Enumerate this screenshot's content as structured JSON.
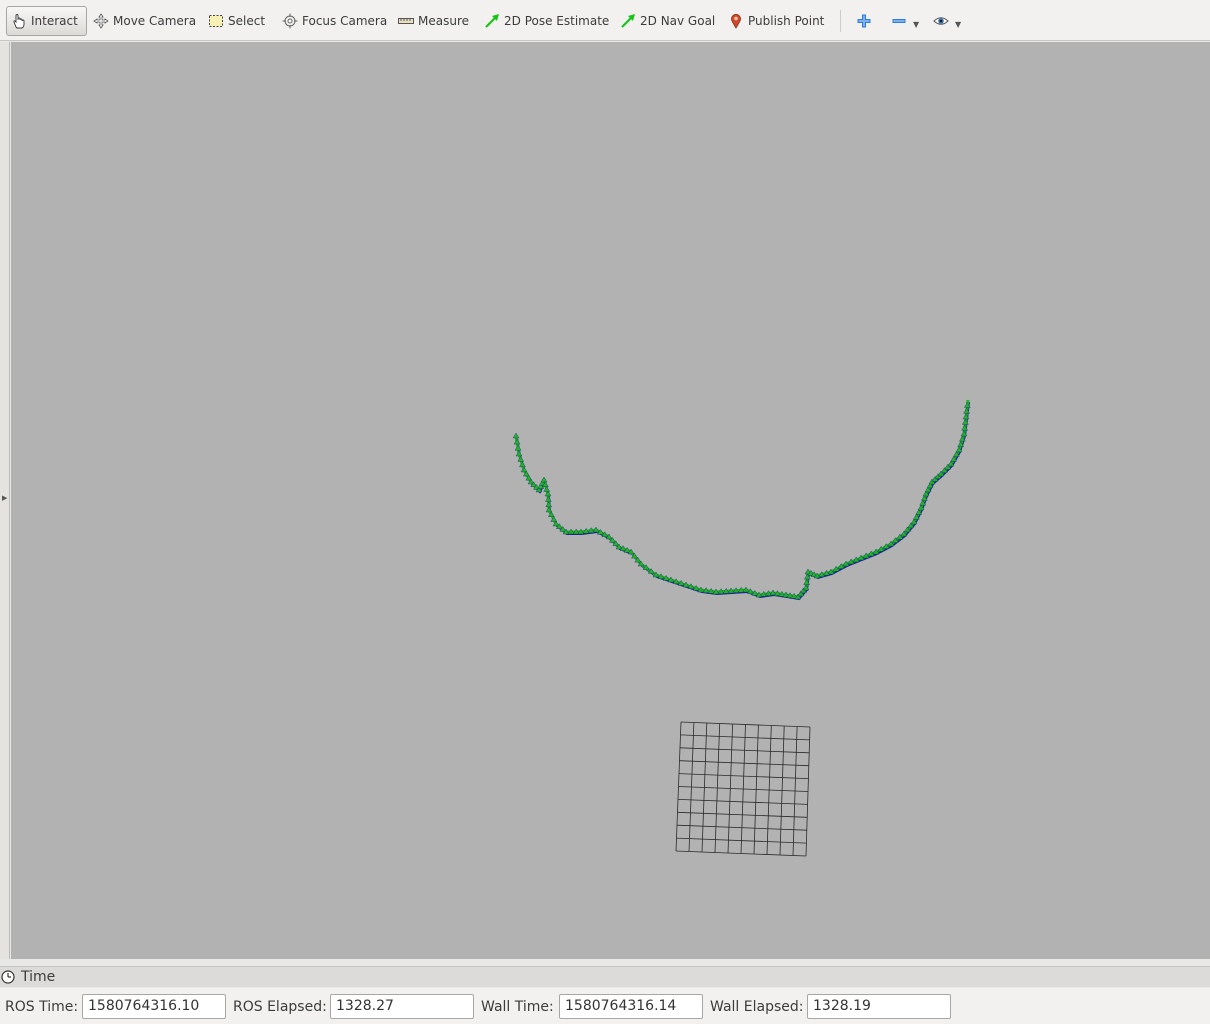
{
  "toolbar": {
    "tools": [
      {
        "label": "Interact",
        "icon": "hand-icon"
      },
      {
        "label": "Move Camera",
        "icon": "move-camera-icon"
      },
      {
        "label": "Select",
        "icon": "select-box-icon"
      },
      {
        "label": "Focus Camera",
        "icon": "focus-camera-icon"
      },
      {
        "label": "Measure",
        "icon": "ruler-icon"
      },
      {
        "label": "2D Pose Estimate",
        "icon": "green-arrow-icon"
      },
      {
        "label": "2D Nav Goal",
        "icon": "green-arrow-icon"
      },
      {
        "label": "Publish Point",
        "icon": "map-pin-icon"
      }
    ],
    "active_tool": "Interact",
    "accent_color": "#2e7dd6"
  },
  "viewport": {
    "background_color": "#b2b2b2",
    "path_color": "#22b422",
    "path_dark_color": "#1a2a8a",
    "grid_color": "#2a2a2a"
  },
  "time_panel": {
    "title": "Time",
    "ros_time_label": "ROS Time:",
    "ros_time_value": "1580764316.10",
    "ros_elapsed_label": "ROS Elapsed:",
    "ros_elapsed_value": "1328.27",
    "wall_time_label": "Wall Time:",
    "wall_time_value": "1580764316.14",
    "wall_elapsed_label": "Wall Elapsed:",
    "wall_elapsed_value": "1328.19"
  }
}
